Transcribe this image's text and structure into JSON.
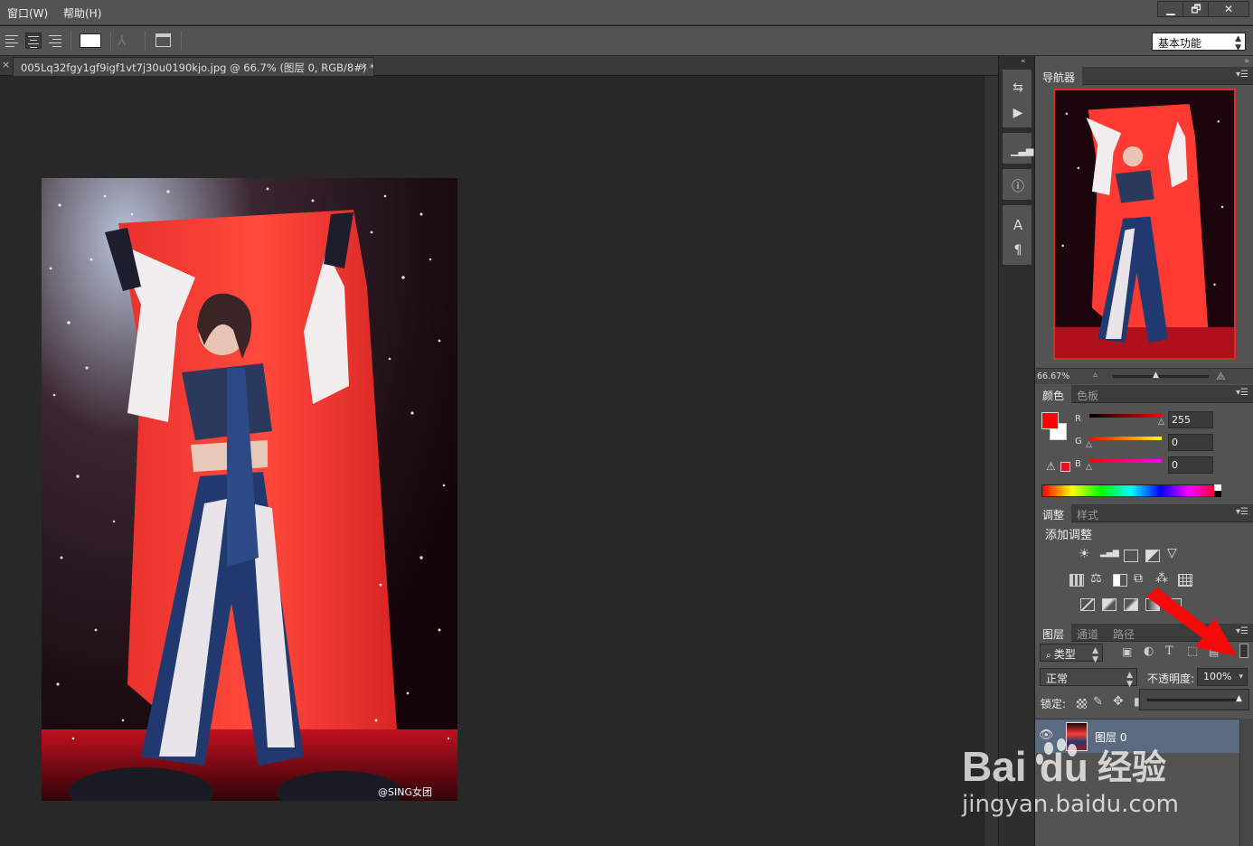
{
  "menubar": {
    "items": [
      "窗口(W)",
      "帮助(H)"
    ],
    "window_buttons": [
      "▁",
      "🗗",
      "✕"
    ]
  },
  "options": {
    "workspace": "基本功能"
  },
  "document": {
    "tab_title": "005Lq32fgy1gf9igf1vt7j30u0190kjo.jpg @ 66.7% (图层 0, RGB/8#) *",
    "close": "×",
    "watermark_credit": "@SING女团"
  },
  "navigator": {
    "tab": "导航器",
    "zoom": "66.67%"
  },
  "color": {
    "tabs": [
      "颜色",
      "色板"
    ],
    "foreground": "#ff0000",
    "background": "#ffffff",
    "r_label": "R",
    "g_label": "G",
    "b_label": "B",
    "r": "255",
    "g": "0",
    "b": "0",
    "r_level": 1.0,
    "g_level": 0.0,
    "b_level": 0.0
  },
  "adjustments": {
    "tabs": [
      "调整",
      "样式"
    ],
    "heading": "添加调整"
  },
  "layers": {
    "tabs": [
      "图层",
      "通道",
      "路径"
    ],
    "filter_kind": "类型",
    "blend_mode": "正常",
    "opacity_label": "不透明度:",
    "opacity": "100%",
    "lock_label": "锁定:",
    "layer_name": "图层 0"
  },
  "watermark": {
    "brand": "Bai",
    "brand_suffix": "du",
    "product": "经验",
    "url": "jingyan.baidu.com"
  },
  "colors": {
    "accent_red": "#e00000",
    "panel_bg": "#535353",
    "selected_layer": "#5a6b80"
  }
}
